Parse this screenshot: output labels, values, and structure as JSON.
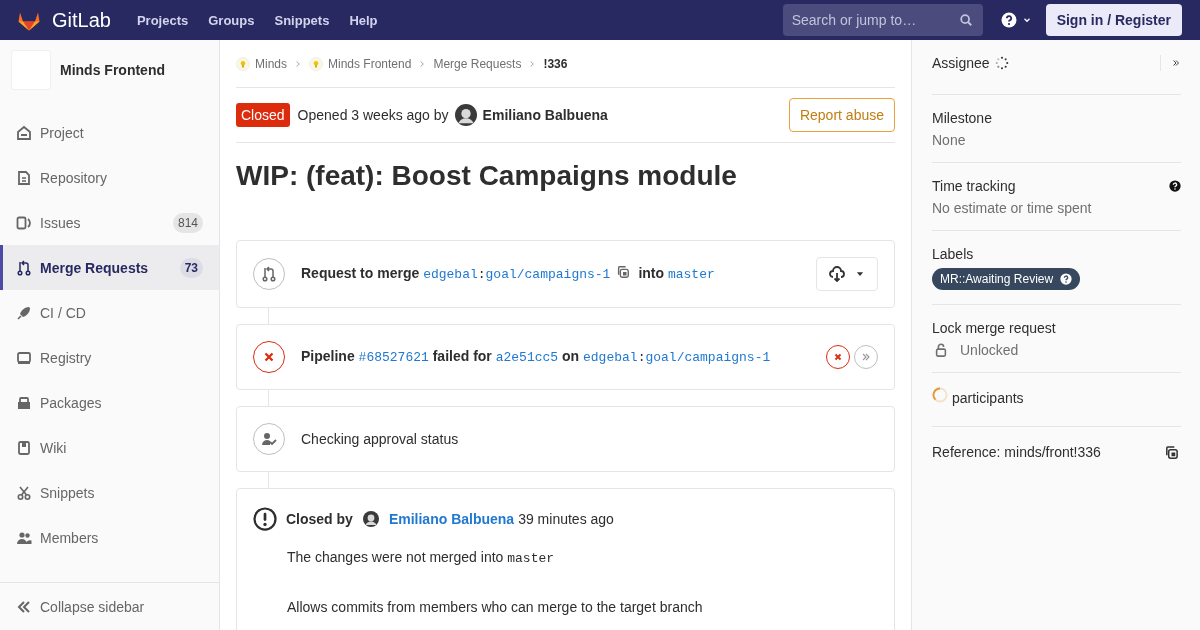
{
  "topbar": {
    "logo_text": "GitLab",
    "nav": [
      "Projects",
      "Groups",
      "Snippets",
      "Help"
    ],
    "search": {
      "placeholder": "Search or jump to…"
    },
    "sign_in": "Sign in / Register"
  },
  "sidebar": {
    "project": "Minds Frontend",
    "items": [
      {
        "label": "Project",
        "selected": false
      },
      {
        "label": "Repository",
        "selected": false
      },
      {
        "label": "Issues",
        "count": "814",
        "selected": false
      },
      {
        "label": "Merge Requests",
        "count": "73",
        "selected": true
      },
      {
        "label": "CI / CD",
        "selected": false
      },
      {
        "label": "Registry",
        "selected": false
      },
      {
        "label": "Packages",
        "selected": false
      },
      {
        "label": "Wiki",
        "selected": false
      },
      {
        "label": "Snippets",
        "selected": false
      },
      {
        "label": "Members",
        "selected": false
      }
    ],
    "collapse": "Collapse sidebar"
  },
  "breadcrumbs": [
    {
      "label": "Minds",
      "kind": "group"
    },
    {
      "label": "Minds Frontend",
      "kind": "group"
    },
    {
      "label": "Merge Requests",
      "kind": "link"
    },
    {
      "label": "!336",
      "kind": "current"
    }
  ],
  "header": {
    "status": "Closed",
    "opened": "Opened 3 weeks ago by",
    "author": "Emiliano Balbuena",
    "report": "Report abuse"
  },
  "title": "WIP: (feat): Boost Campaigns module",
  "widgets": [
    {
      "kind": "merge",
      "segments": [
        {
          "kind": "bold",
          "text": "Request to merge "
        },
        {
          "kind": "code-link",
          "text": "edgebal"
        },
        {
          "kind": "code",
          "text": ":"
        },
        {
          "kind": "code-link",
          "text": "goal/campaigns-1"
        },
        {
          "kind": "copy"
        },
        {
          "kind": "bold",
          "text": "into "
        },
        {
          "kind": "code-link",
          "text": "master"
        }
      ]
    },
    {
      "kind": "pipeline",
      "segments": [
        {
          "kind": "bold",
          "text": "Pipeline "
        },
        {
          "kind": "code-link",
          "text": "#68527621"
        },
        {
          "kind": "bold",
          "text": " failed for "
        },
        {
          "kind": "code-link",
          "text": "a2e51cc5"
        },
        {
          "kind": "bold",
          "text": " on "
        },
        {
          "kind": "code-link",
          "text": "edgebal"
        },
        {
          "kind": "code",
          "text": ":"
        },
        {
          "kind": "code-link",
          "text": "goal/campaigns-1"
        }
      ]
    },
    {
      "kind": "approval",
      "segments": [
        {
          "kind": "text",
          "text": "Checking approval status"
        }
      ]
    }
  ],
  "note": {
    "label": "Closed by",
    "author": "Emiliano Balbuena",
    "time": "39 minutes ago",
    "message": [
      {
        "kind": "text",
        "text": "The changes were not merged into "
      },
      {
        "kind": "code",
        "text": "master"
      }
    ],
    "detail": "Allows commits from members who can merge to the target branch"
  },
  "right_sidebar": {
    "sections": [
      {
        "kind": "assignee",
        "title": "Assignee"
      },
      {
        "kind": "value",
        "title": "Milestone",
        "value": "None"
      },
      {
        "kind": "value",
        "title": "Time tracking",
        "value": "No estimate or time spent",
        "help": true
      },
      {
        "kind": "labels",
        "title": "Labels",
        "labels": [
          "MR::Awaiting Review"
        ]
      },
      {
        "kind": "lock",
        "title": "Lock merge request",
        "value": "Unlocked"
      },
      {
        "kind": "participants",
        "title": "participants"
      },
      {
        "kind": "reference",
        "title": "Reference: minds/front!336"
      }
    ]
  }
}
